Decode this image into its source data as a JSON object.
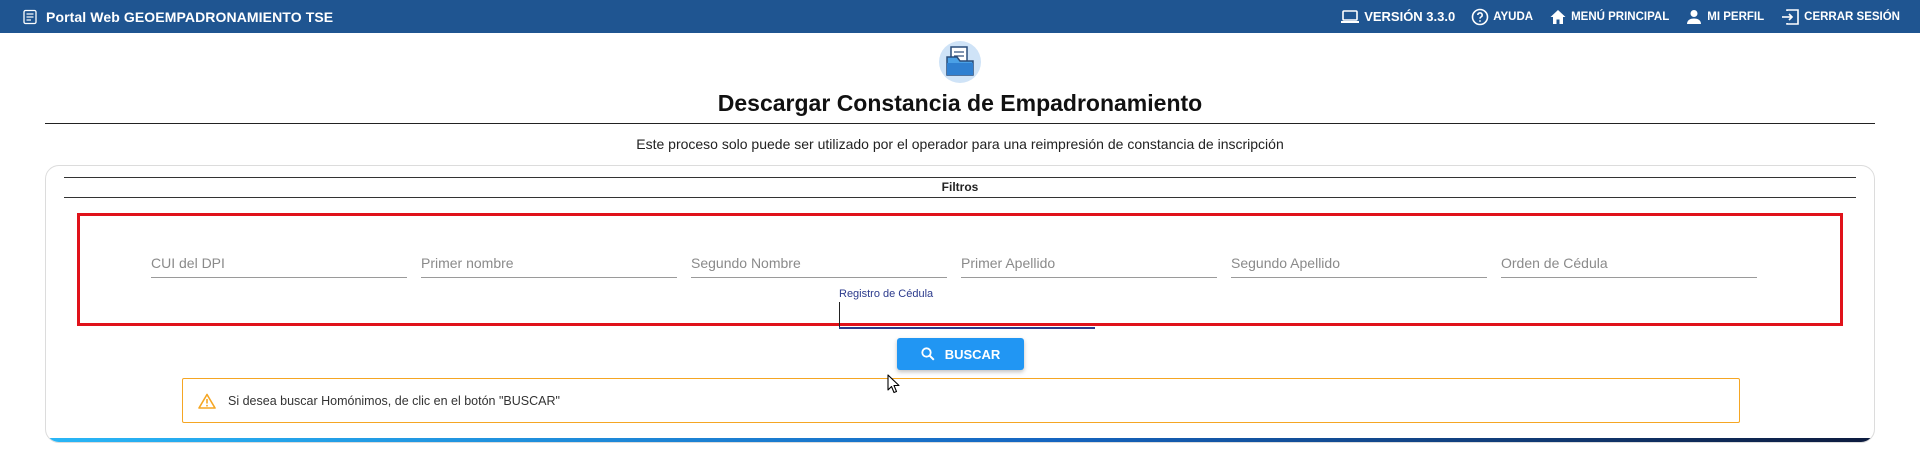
{
  "header": {
    "app_title": "Portal Web GEOEMPADRONAMIENTO TSE",
    "version": "VERSIÓN 3.3.0",
    "help": "AYUDA",
    "main_menu": "MENÚ PRINCIPAL",
    "profile": "MI PERFIL",
    "logout": "CERRAR SESIÓN"
  },
  "page": {
    "title": "Descargar Constancia de Empadronamiento",
    "subtitle": "Este proceso solo puede ser utilizado por el operador para una reimpresión de constancia de inscripción"
  },
  "filters": {
    "section_label": "Filtros",
    "cui_placeholder": "CUI del DPI",
    "first_name_placeholder": "Primer nombre",
    "second_name_placeholder": "Segundo Nombre",
    "first_surname_placeholder": "Primer Apellido",
    "second_surname_placeholder": "Segundo Apellido",
    "cedula_order_placeholder": "Orden de Cédula",
    "cedula_registry_label": "Registro de Cédula",
    "cedula_registry_value": ""
  },
  "actions": {
    "search_label": "BUSCAR"
  },
  "notice": {
    "text": "Si desea buscar Homónimos, de clic en el botón \"BUSCAR\""
  },
  "colors": {
    "topbar": "#1f5591",
    "highlight_border": "#e0121a",
    "button": "#2196f3",
    "warning_border": "#f5a623"
  },
  "icons": {
    "brand": "id-card-icon",
    "version": "laptop-icon",
    "help": "help-circle-icon",
    "main_menu": "home-icon",
    "profile": "person-icon",
    "logout": "logout-icon",
    "page": "document-folder-icon",
    "search": "search-icon",
    "warning": "warning-icon"
  }
}
